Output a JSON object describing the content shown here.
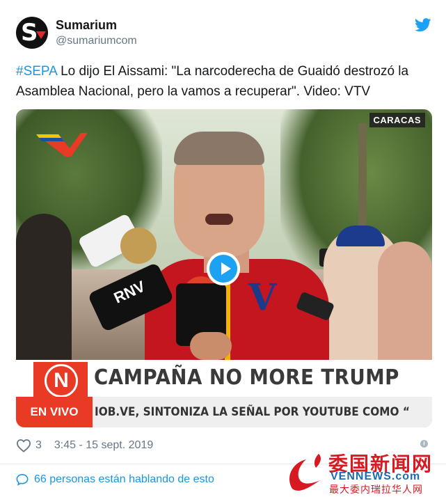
{
  "author": {
    "name": "Sumarium",
    "handle": "@sumariumcom",
    "avatar_icon": "sumarium-logo"
  },
  "tweet": {
    "hashtag": "#SEPA",
    "body": " Lo dijo El Aissami: \"La narcoderecha de Guaidó destrozó la Asamblea Nacional, pero la vamos a recuperar\". Video: VTV"
  },
  "video": {
    "location_tag": "CARACAS",
    "channel_logo": "N",
    "headline": "CAMPAÑA NO MORE TRUMP",
    "live_label": "EN VIVO",
    "ticker": "IOB.VE, SINTONIZA LA SEÑAL POR YOUTUBE COMO “",
    "mic_brand": "RNV",
    "play_icon": "play-icon"
  },
  "meta": {
    "likes": "3",
    "timestamp": "3:45 - 15 sept. 2019"
  },
  "footer": {
    "talking": "66 personas están hablando de esto"
  },
  "watermark": {
    "title": "委国新闻网",
    "url": "VENNEWS.com",
    "sub": "最大委内瑞拉华人网"
  },
  "colors": {
    "link": "#1b95e0",
    "brand_red": "#e83a24",
    "twitter_blue": "#1da1f2"
  }
}
